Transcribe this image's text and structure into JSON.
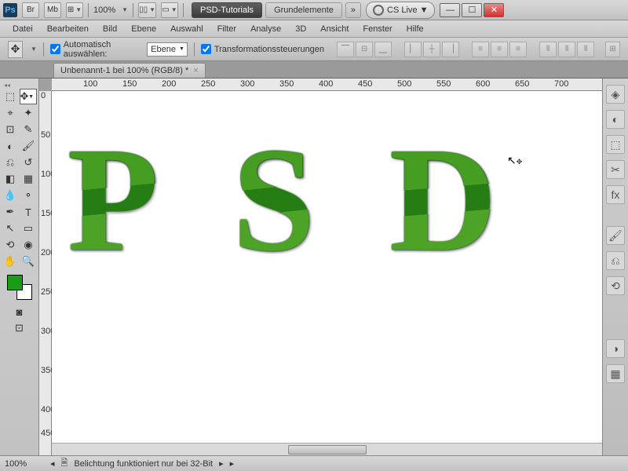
{
  "titlebar": {
    "zoom": "100%",
    "workspaces": [
      "PSD-Tutorials",
      "Grundelemente"
    ],
    "overflow": "»",
    "cslive": "CS Live ▼"
  },
  "menu": [
    "Datei",
    "Bearbeiten",
    "Bild",
    "Ebene",
    "Auswahl",
    "Filter",
    "Analyse",
    "3D",
    "Ansicht",
    "Fenster",
    "Hilfe"
  ],
  "options": {
    "auto_select": "Automatisch auswählen:",
    "layer_dropdown": "Ebene",
    "transform": "Transformationssteuerungen"
  },
  "doctab": {
    "title": "Unbenannt-1 bei 100% (RGB/8) *"
  },
  "ruler_h": [
    "100",
    "150",
    "200",
    "250",
    "300",
    "350",
    "400",
    "450",
    "500",
    "550",
    "600",
    "650",
    "700"
  ],
  "ruler_v": [
    "0",
    "50",
    "100",
    "150",
    "200",
    "250",
    "300",
    "350",
    "400",
    "450"
  ],
  "canvas": {
    "letters": [
      "P",
      "S",
      "D"
    ]
  },
  "status": {
    "zoom": "100%",
    "msg": "Belichtung funktioniert nur bei 32-Bit"
  },
  "colors": {
    "fg": "#1a9b1a",
    "bg": "#ffffff"
  }
}
